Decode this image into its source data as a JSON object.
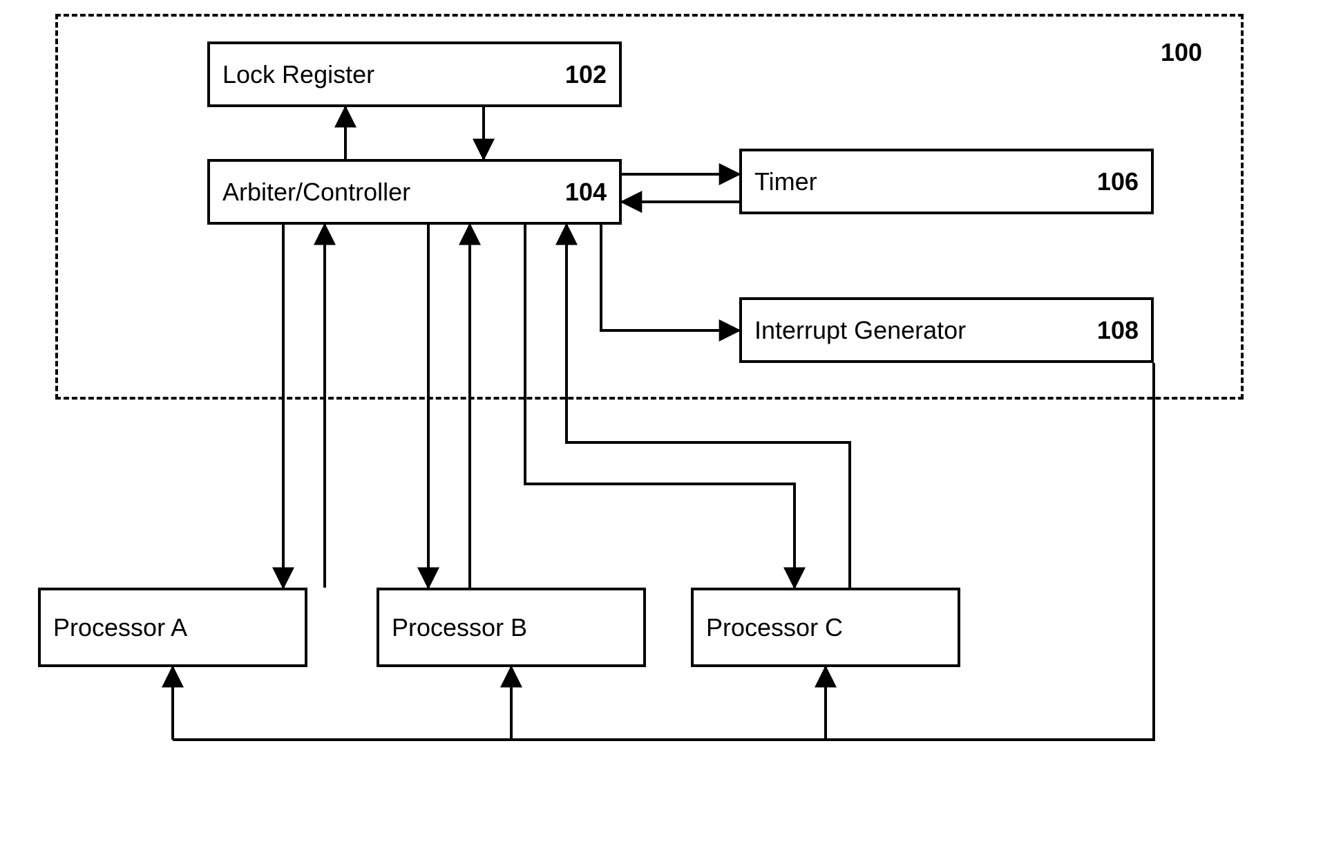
{
  "container": {
    "ref": "100"
  },
  "blocks": {
    "lock_register": {
      "label": "Lock Register",
      "ref": "102"
    },
    "arbiter_controller": {
      "label": "Arbiter/Controller",
      "ref": "104"
    },
    "timer": {
      "label": "Timer",
      "ref": "106"
    },
    "interrupt_generator": {
      "label": "Interrupt Generator",
      "ref": "108"
    },
    "processor_a": {
      "label": "Processor A"
    },
    "processor_b": {
      "label": "Processor B"
    },
    "processor_c": {
      "label": "Processor C"
    }
  }
}
